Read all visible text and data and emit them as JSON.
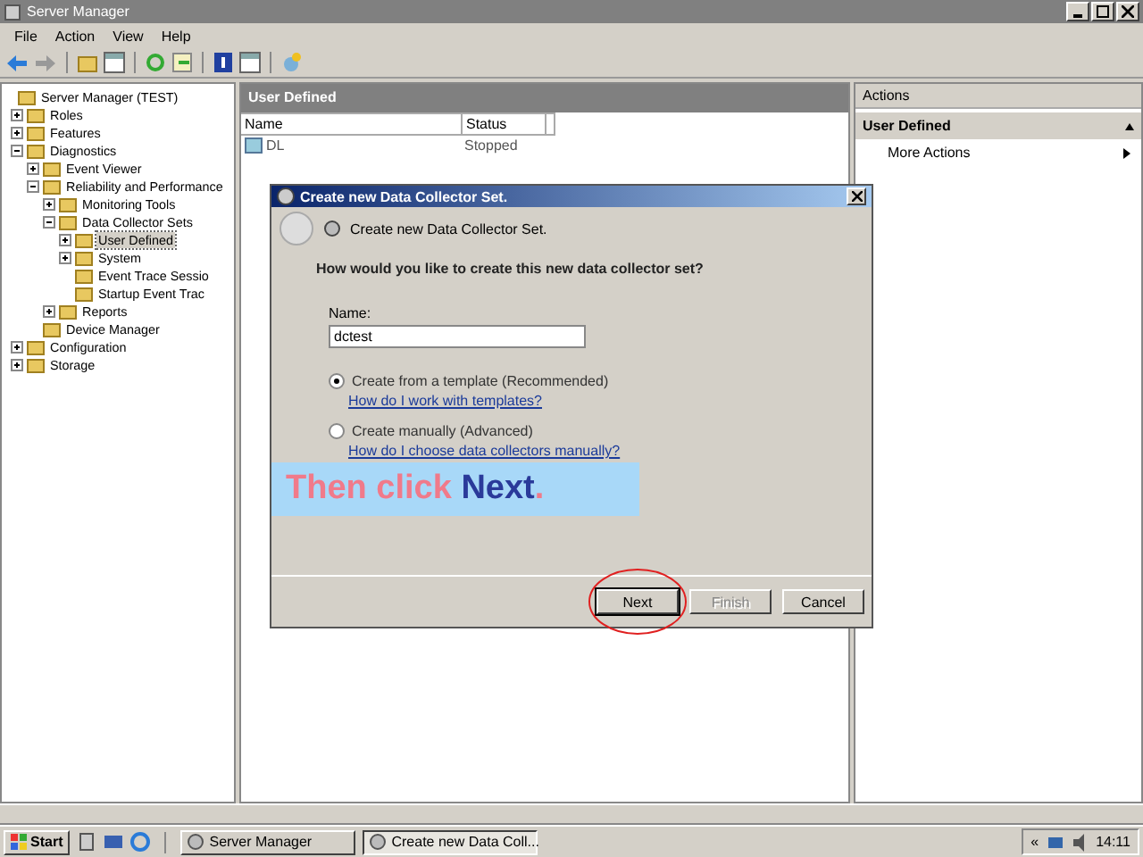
{
  "window": {
    "title": "Server Manager"
  },
  "menu": [
    "File",
    "Action",
    "View",
    "Help"
  ],
  "tree": [
    {
      "label": "Server Manager (TEST)",
      "selected": false,
      "children": [
        {
          "label": "Roles",
          "expanded": false,
          "selected": false
        },
        {
          "label": "Features",
          "expanded": false,
          "selected": false
        },
        {
          "label": "Diagnostics",
          "expanded": true,
          "selected": false,
          "children": [
            {
              "label": "Event Viewer",
              "expanded": false,
              "selected": false
            },
            {
              "label": "Reliability and Performance",
              "expanded": true,
              "selected": false,
              "children": [
                {
                  "label": "Monitoring Tools",
                  "expanded": false,
                  "selected": false
                },
                {
                  "label": "Data Collector Sets",
                  "expanded": true,
                  "selected": false,
                  "children": [
                    {
                      "label": "User Defined",
                      "expanded": false,
                      "selected": true
                    },
                    {
                      "label": "System",
                      "expanded": false,
                      "selected": false
                    },
                    {
                      "label": "Event Trace Sessio",
                      "selected": false
                    },
                    {
                      "label": "Startup Event Trac",
                      "selected": false
                    }
                  ]
                },
                {
                  "label": "Reports",
                  "expanded": false,
                  "selected": false
                }
              ]
            },
            {
              "label": "Device Manager",
              "selected": false
            }
          ]
        },
        {
          "label": "Configuration",
          "expanded": false,
          "selected": false
        },
        {
          "label": "Storage",
          "expanded": false,
          "selected": false
        }
      ]
    }
  ],
  "center": {
    "title": "User Defined",
    "columns": [
      "Name",
      "Status"
    ],
    "rows": [
      {
        "name": "DL",
        "status": "Stopped"
      }
    ]
  },
  "actions": {
    "title": "Actions",
    "section": "User Defined",
    "items": [
      "More Actions"
    ]
  },
  "dialog": {
    "title": "Create new Data Collector Set.",
    "heading": "Create new Data Collector Set.",
    "question": "How would you like to create this new data collector set?",
    "name_label": "Name:",
    "name_value": "dctest",
    "options": [
      {
        "label": "Create from a template (Recommended)",
        "link": "How do I work with templates?",
        "selected": true
      },
      {
        "label": "Create manually (Advanced)",
        "link": "How do I choose data collectors manually?",
        "selected": false
      }
    ],
    "callout": {
      "lead": "Then click ",
      "keyword": "Next",
      "tail": "."
    },
    "buttons": [
      {
        "label": "Next",
        "disabled": false,
        "circled": true
      },
      {
        "label": "Finish",
        "disabled": true,
        "circled": false
      },
      {
        "label": "Cancel",
        "disabled": false,
        "circled": false
      }
    ]
  },
  "taskbar": {
    "start": "Start",
    "tasks": [
      {
        "label": "Server Manager",
        "selected": false
      },
      {
        "label": "Create new Data Coll...",
        "selected": true
      }
    ],
    "tray_chevron": "«",
    "clock": "14:11"
  }
}
